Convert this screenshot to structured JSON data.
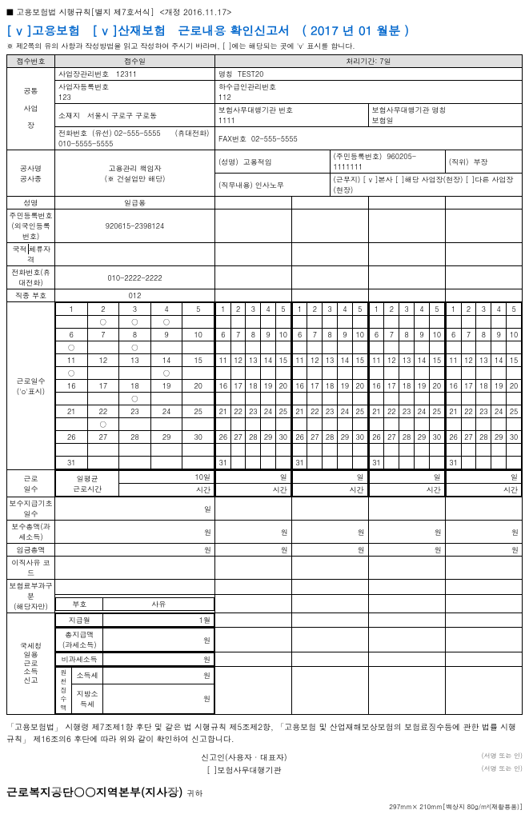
{
  "hdr": {
    "form": "■ 고용보험법 시행규칙[별지 제7호서식]",
    "rev": "<개정 2016.11.17>"
  },
  "title": {
    "a": "[ v ]고용보험",
    "b": "[ v ]산재보험",
    "c": "근로내용 확인신고서",
    "d": "( 2017 년 01 월분 )"
  },
  "note": "※ 제2쪽의 유의 사항과 작성방법을 읽고 작성하여 주시기 바라며, [ ]에는 해당되는 곳에 'v' 표시를 합니다.",
  "tbl": {
    "recno_l": "접수번호",
    "recdate_l": "접수일",
    "period_l": "처리기간: 7일",
    "bizmgr_l": "사업장관리번호",
    "bizmgr": "12311",
    "name_l": "명칭",
    "name": "TEST20",
    "bizreg_l": "사업자등록번호",
    "bizreg": "123",
    "sub_l": "하수급인관리번호",
    "sub": "112",
    "common_l": "공통",
    "biz_l": "사업",
    "jang_l": "장",
    "loc_l": "소재지",
    "loc": "서울시 구로구 구로동",
    "agentno_l": "보험사무대행기관 번호",
    "agentno": "1111",
    "agentnm_l": "보험사무대행기관 명칭",
    "agentnm": "보험일",
    "tel_l": "전화번호",
    "tel_w": "(유선) 02-555-5555",
    "tel_m": "(휴대전화) 010-5555-5555",
    "fax_l": "FAX번호",
    "fax": "02-555-5555",
    "co_l": "공사명",
    "co2_l": "공사종",
    "mgr_l": "고용관리 책임자\n(※ 건설업만 해당)",
    "mgr_nm_l": "(성명)",
    "mgr_nm": "고용적임",
    "mgr_rrn_l": "(주민등록번호)",
    "mgr_rrn": "960205-1111111",
    "mgr_pos_l": "(직위)",
    "mgr_pos": "부장",
    "mgr_job_l": "(직무내용)",
    "mgr_job": "인사노무",
    "mgr_wp_l": "(근무지) [ v ]본사  [  ]해당 사업장(현장)  [  ]다른 사업장(현장)",
    "p_name_l": "성명",
    "p_name": "일급용",
    "p_rrn_l": "주민등록번호\n(외국인등록번호)",
    "p_rrn": "920615-2398124",
    "nat_l": "국적",
    "stay_l": "체류자격",
    "p_tel_l": "전화번호(휴대전화)",
    "p_tel": "010-2222-2222",
    "job_l": "직종 부호",
    "job": "012",
    "workdays_l": "근로일수\n('o'표시)",
    "wl": {
      "c1": "근로",
      "c2": "일수",
      "c3": "일평균\n근로시간",
      "d": "10일",
      "h": "시간",
      "day": "일",
      "won": "원",
      "m": "1월"
    },
    "basedays_l": "보수지급기초일수",
    "total_l": "보수총액(과세소득)",
    "wagetot_l": "임금총액",
    "leave_l": "이직사유 코드",
    "ins_l": "보험료부과구분\n(해당자만)",
    "sign_l": "부호",
    "reason_l": "사유",
    "tax_l": "국세청\n일용\n근로\n소득\n신고",
    "paym_l": "지급월",
    "total2_l": "총지급액\n(과세소득)",
    "nontax_l": "비과세소득",
    "orig_l": "원\n천\n징\n수\n액",
    "inc_l": "소득세",
    "loc_tax_l": "지방소득세"
  },
  "cal": {
    "r1": [
      "1",
      "2",
      "3",
      "4",
      "5"
    ],
    "r1m": [
      "",
      "○",
      "○",
      "○",
      ""
    ],
    "r2": [
      "6",
      "7",
      "8",
      "9",
      "10"
    ],
    "r2m": [
      "○",
      "",
      "○",
      "",
      ""
    ],
    "r3": [
      "11",
      "12",
      "13",
      "14",
      "15"
    ],
    "r3m": [
      "○",
      "",
      "",
      "○",
      ""
    ],
    "r4": [
      "16",
      "17",
      "18",
      "19",
      "20"
    ],
    "r4m": [
      "",
      "",
      "○",
      "",
      ""
    ],
    "r5": [
      "21",
      "22",
      "23",
      "24",
      "25"
    ],
    "r5m": [
      "",
      "○",
      "",
      "",
      ""
    ],
    "r6": [
      "26",
      "27",
      "28",
      "29",
      "30"
    ],
    "r7": [
      "31"
    ]
  },
  "ft": {
    "t": "「고용보험법」 시행령 제7조제1항 후단 및 같은 법 시행규칙 제5조제2항, 「고용보험 및 산업재해보상보험의 보험료징수등에 관한 법률 시행규칙」 제16조의6 후단에 따라 위와 같이 확인하여 신고합니다.",
    "s1": "신고인(사용자 · 대표자)",
    "s2": "[     ]보험사무대행기관",
    "sr": "(서명 또는 인)",
    "org": "근로복지공단○○지역본부(지사장)",
    "to": "귀하",
    "paper": "297mm× 210mm[백상지  80g/m²(재활용품)]"
  }
}
